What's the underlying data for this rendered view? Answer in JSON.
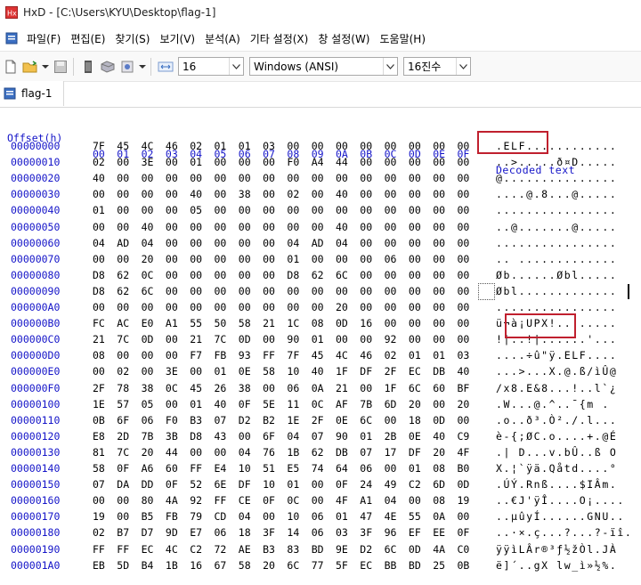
{
  "window": {
    "title": "HxD - [C:\\Users\\KYU\\Desktop\\flag-1]"
  },
  "menu": [
    "파일(F)",
    "편집(E)",
    "찾기(S)",
    "보기(V)",
    "분석(A)",
    "기타 설정(X)",
    "창 설정(W)",
    "도움말(H)"
  ],
  "toolbar": {
    "bytes_per_row": "16",
    "charset": "Windows (ANSI)",
    "offset_base": "16진수"
  },
  "tab": {
    "label": "flag-1"
  },
  "hex_header": {
    "offset": "Offset(h)",
    "columns": [
      "00",
      "01",
      "02",
      "03",
      "04",
      "05",
      "06",
      "07",
      "08",
      "09",
      "0A",
      "0B",
      "0C",
      "0D",
      "0E",
      "0F"
    ],
    "decoded": "Decoded text"
  },
  "rows": [
    {
      "offset": "00000000",
      "bytes": [
        "7F",
        "45",
        "4C",
        "46",
        "02",
        "01",
        "01",
        "03",
        "00",
        "00",
        "00",
        "00",
        "00",
        "00",
        "00",
        "00"
      ],
      "text": ".ELF............"
    },
    {
      "offset": "00000010",
      "bytes": [
        "02",
        "00",
        "3E",
        "00",
        "01",
        "00",
        "00",
        "00",
        "F0",
        "A4",
        "44",
        "00",
        "00",
        "00",
        "00",
        "00"
      ],
      "text": "..>.....ð¤D....."
    },
    {
      "offset": "00000020",
      "bytes": [
        "40",
        "00",
        "00",
        "00",
        "00",
        "00",
        "00",
        "00",
        "00",
        "00",
        "00",
        "00",
        "00",
        "00",
        "00",
        "00"
      ],
      "text": "@..............."
    },
    {
      "offset": "00000030",
      "bytes": [
        "00",
        "00",
        "00",
        "00",
        "40",
        "00",
        "38",
        "00",
        "02",
        "00",
        "40",
        "00",
        "00",
        "00",
        "00",
        "00"
      ],
      "text": "....@.8...@....."
    },
    {
      "offset": "00000040",
      "bytes": [
        "01",
        "00",
        "00",
        "00",
        "05",
        "00",
        "00",
        "00",
        "00",
        "00",
        "00",
        "00",
        "00",
        "00",
        "00",
        "00"
      ],
      "text": "................"
    },
    {
      "offset": "00000050",
      "bytes": [
        "00",
        "00",
        "40",
        "00",
        "00",
        "00",
        "00",
        "00",
        "00",
        "00",
        "40",
        "00",
        "00",
        "00",
        "00",
        "00"
      ],
      "text": "..@.......@....."
    },
    {
      "offset": "00000060",
      "bytes": [
        "04",
        "AD",
        "04",
        "00",
        "00",
        "00",
        "00",
        "00",
        "04",
        "AD",
        "04",
        "00",
        "00",
        "00",
        "00",
        "00"
      ],
      "text": "................"
    },
    {
      "offset": "00000070",
      "bytes": [
        "00",
        "00",
        "20",
        "00",
        "00",
        "00",
        "00",
        "00",
        "01",
        "00",
        "00",
        "00",
        "06",
        "00",
        "00",
        "00"
      ],
      "text": ".. ............."
    },
    {
      "offset": "00000080",
      "bytes": [
        "D8",
        "62",
        "0C",
        "00",
        "00",
        "00",
        "00",
        "00",
        "D8",
        "62",
        "6C",
        "00",
        "00",
        "00",
        "00",
        "00"
      ],
      "text": "Øb......Øbl....."
    },
    {
      "offset": "00000090",
      "bytes": [
        "D8",
        "62",
        "6C",
        "00",
        "00",
        "00",
        "00",
        "00",
        "00",
        "00",
        "00",
        "00",
        "00",
        "00",
        "00",
        "00"
      ],
      "text": "Øbl............."
    },
    {
      "offset": "000000A0",
      "bytes": [
        "00",
        "00",
        "00",
        "00",
        "00",
        "00",
        "00",
        "00",
        "00",
        "00",
        "20",
        "00",
        "00",
        "00",
        "00",
        "00"
      ],
      "text": "................"
    },
    {
      "offset": "000000B0",
      "bytes": [
        "FC",
        "AC",
        "E0",
        "A1",
        "55",
        "50",
        "58",
        "21",
        "1C",
        "08",
        "0D",
        "16",
        "00",
        "00",
        "00",
        "00"
      ],
      "text": "ü¬à¡UPX!........"
    },
    {
      "offset": "000000C0",
      "bytes": [
        "21",
        "7C",
        "0D",
        "00",
        "21",
        "7C",
        "0D",
        "00",
        "90",
        "01",
        "00",
        "00",
        "92",
        "00",
        "00",
        "00"
      ],
      "text": "!|..!|......'..."
    },
    {
      "offset": "000000D0",
      "bytes": [
        "08",
        "00",
        "00",
        "00",
        "F7",
        "FB",
        "93",
        "FF",
        "7F",
        "45",
        "4C",
        "46",
        "02",
        "01",
        "01",
        "03"
      ],
      "text": "....÷û\"ÿ.ELF...."
    },
    {
      "offset": "000000E0",
      "bytes": [
        "00",
        "02",
        "00",
        "3E",
        "00",
        "01",
        "0E",
        "58",
        "10",
        "40",
        "1F",
        "DF",
        "2F",
        "EC",
        "DB",
        "40"
      ],
      "text": "...>...X.@.ß/ìÛ@"
    },
    {
      "offset": "000000F0",
      "bytes": [
        "2F",
        "78",
        "38",
        "0C",
        "45",
        "26",
        "38",
        "00",
        "06",
        "0A",
        "21",
        "00",
        "1F",
        "6C",
        "60",
        "BF"
      ],
      "text": "/x8.E&8...!..l`¿"
    },
    {
      "offset": "00000100",
      "bytes": [
        "1E",
        "57",
        "05",
        "00",
        "01",
        "40",
        "0F",
        "5E",
        "11",
        "0C",
        "AF",
        "7B",
        "6D",
        "20",
        "00",
        "20"
      ],
      "text": ".W...@.^..¯{m . "
    },
    {
      "offset": "00000110",
      "bytes": [
        "0B",
        "6F",
        "06",
        "F0",
        "B3",
        "07",
        "D2",
        "B2",
        "1E",
        "2F",
        "0E",
        "6C",
        "00",
        "18",
        "0D",
        "00"
      ],
      "text": ".o..ð³.Ò²./.l..."
    },
    {
      "offset": "00000120",
      "bytes": [
        "E8",
        "2D",
        "7B",
        "3B",
        "D8",
        "43",
        "00",
        "6F",
        "04",
        "07",
        "90",
        "01",
        "2B",
        "0E",
        "40",
        "C9"
      ],
      "text": "è-{;ØC.o....+.@É"
    },
    {
      "offset": "00000130",
      "bytes": [
        "81",
        "7C",
        "20",
        "44",
        "00",
        "00",
        "04",
        "76",
        "1B",
        "62",
        "DB",
        "07",
        "17",
        "DF",
        "20",
        "4F"
      ],
      "text": ".| D...v.bÛ..ß O"
    },
    {
      "offset": "00000140",
      "bytes": [
        "58",
        "0F",
        "A6",
        "60",
        "FF",
        "E4",
        "10",
        "51",
        "E5",
        "74",
        "64",
        "06",
        "00",
        "01",
        "08",
        "B0"
      ],
      "text": "X.¦`ÿä.Qåtd....°"
    },
    {
      "offset": "00000150",
      "bytes": [
        "07",
        "DA",
        "DD",
        "0F",
        "52",
        "6E",
        "DF",
        "10",
        "01",
        "00",
        "0F",
        "24",
        "49",
        "C2",
        "6D",
        "0D"
      ],
      "text": ".ÚÝ.Rnß....$IÂm."
    },
    {
      "offset": "00000160",
      "bytes": [
        "00",
        "00",
        "80",
        "4A",
        "92",
        "FF",
        "CE",
        "0F",
        "0C",
        "00",
        "4F",
        "A1",
        "04",
        "00",
        "08",
        "19"
      ],
      "text": "..€J'ÿÎ....O¡...."
    },
    {
      "offset": "00000170",
      "bytes": [
        "19",
        "00",
        "B5",
        "FB",
        "79",
        "CD",
        "04",
        "00",
        "10",
        "06",
        "01",
        "47",
        "4E",
        "55",
        "0A",
        "00"
      ],
      "text": "..µûyÍ......GNU.."
    },
    {
      "offset": "00000180",
      "bytes": [
        "02",
        "B7",
        "D7",
        "9D",
        "E7",
        "06",
        "18",
        "3F",
        "14",
        "06",
        "03",
        "3F",
        "96",
        "EF",
        "EE",
        "0F"
      ],
      "text": "..·×.ç...?...?-ïî."
    },
    {
      "offset": "00000190",
      "bytes": [
        "FF",
        "FF",
        "EC",
        "4C",
        "C2",
        "72",
        "AE",
        "B3",
        "83",
        "BD",
        "9E",
        "D2",
        "6C",
        "0D",
        "4A",
        "C0"
      ],
      "text": "ÿÿìLÂr®³ƒ½žÒl.JÀ"
    },
    {
      "offset": "000001A0",
      "bytes": [
        "EB",
        "5D",
        "B4",
        "1B",
        "16",
        "67",
        "58",
        "20",
        "6C",
        "77",
        "5F",
        "EC",
        "BB",
        "BD",
        "25",
        "0B"
      ],
      "text": "ë]´..gX lw_ì»½%."
    }
  ]
}
